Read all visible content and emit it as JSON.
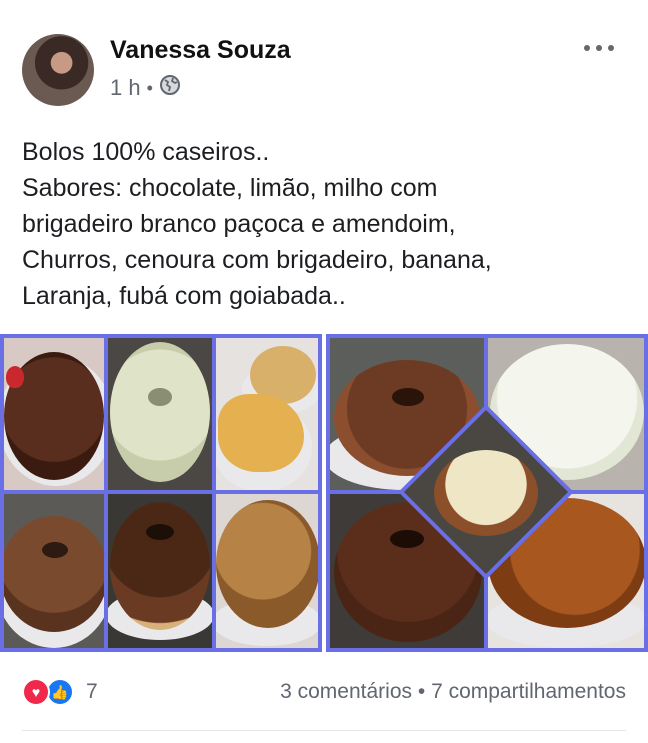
{
  "post": {
    "author": "Vanessa Souza",
    "time": "1 h",
    "separator": "•",
    "privacy_icon": "globe-icon",
    "text_lines": [
      "Bolos 100% caseiros..",
      "Sabores: chocolate, limão, milho com",
      "brigadeiro branco paçoca e amendoim,",
      "Churros, cenoura com brigadeiro, banana,",
      "Laranja, fubá com goiabada.."
    ]
  },
  "reactions": {
    "icons": [
      "love-icon",
      "like-icon"
    ],
    "count": "7",
    "comments": "3 comentários",
    "separator": "•",
    "shares": "7 compartilhamentos"
  },
  "colors": {
    "collage_border": "#6b6fe6",
    "love": "#f02849",
    "like": "#1877f2"
  }
}
